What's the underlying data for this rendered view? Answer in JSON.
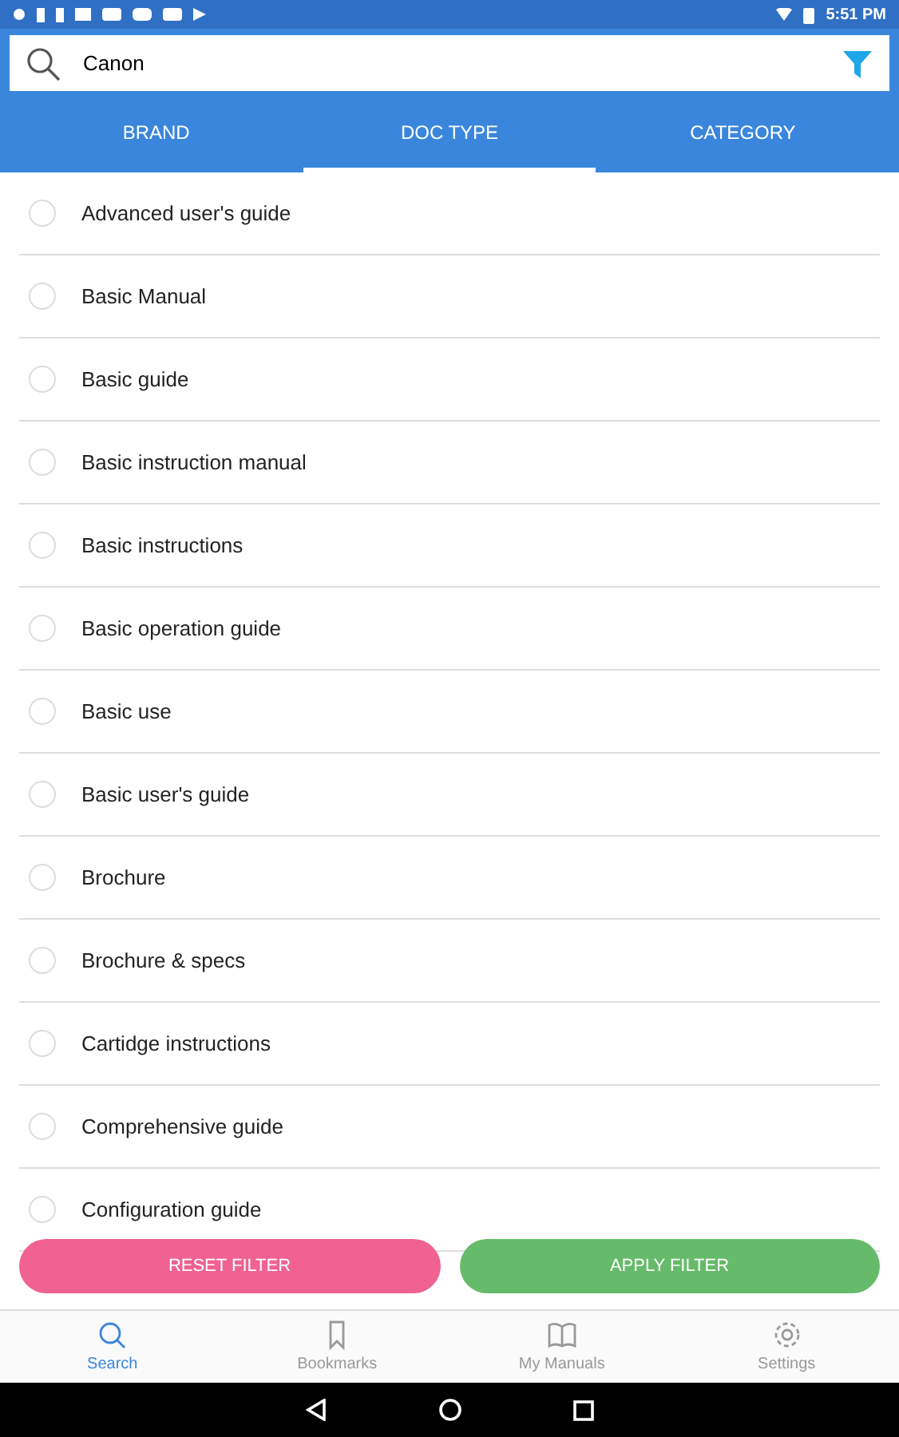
{
  "status_bar": {
    "time": "5:51 PM"
  },
  "search": {
    "value": "Canon"
  },
  "tabs": [
    {
      "label": "BRAND",
      "selected": false
    },
    {
      "label": "DOC TYPE",
      "selected": true
    },
    {
      "label": "CATEGORY",
      "selected": false
    }
  ],
  "items": [
    {
      "label": "Advanced user's guide",
      "selected": false
    },
    {
      "label": "Basic Manual",
      "selected": false
    },
    {
      "label": "Basic guide",
      "selected": false
    },
    {
      "label": "Basic instruction manual",
      "selected": false
    },
    {
      "label": "Basic instructions",
      "selected": false
    },
    {
      "label": "Basic operation guide",
      "selected": false
    },
    {
      "label": "Basic use",
      "selected": false
    },
    {
      "label": "Basic user's guide",
      "selected": false
    },
    {
      "label": "Brochure",
      "selected": false
    },
    {
      "label": "Brochure & specs",
      "selected": false
    },
    {
      "label": "Cartidge instructions",
      "selected": false
    },
    {
      "label": "Comprehensive guide",
      "selected": false
    },
    {
      "label": "Configuration guide",
      "selected": false
    }
  ],
  "buttons": [
    {
      "label": "RESET FILTER",
      "kind": "reset"
    },
    {
      "label": "APPLY FILTER",
      "kind": "apply"
    }
  ],
  "nav": [
    {
      "label": "Search",
      "kind": "search",
      "selected": true
    },
    {
      "label": "Bookmarks",
      "kind": "bookmark",
      "selected": false
    },
    {
      "label": "My Manuals",
      "kind": "book",
      "selected": false
    },
    {
      "label": "Settings",
      "kind": "gear",
      "selected": false
    }
  ]
}
